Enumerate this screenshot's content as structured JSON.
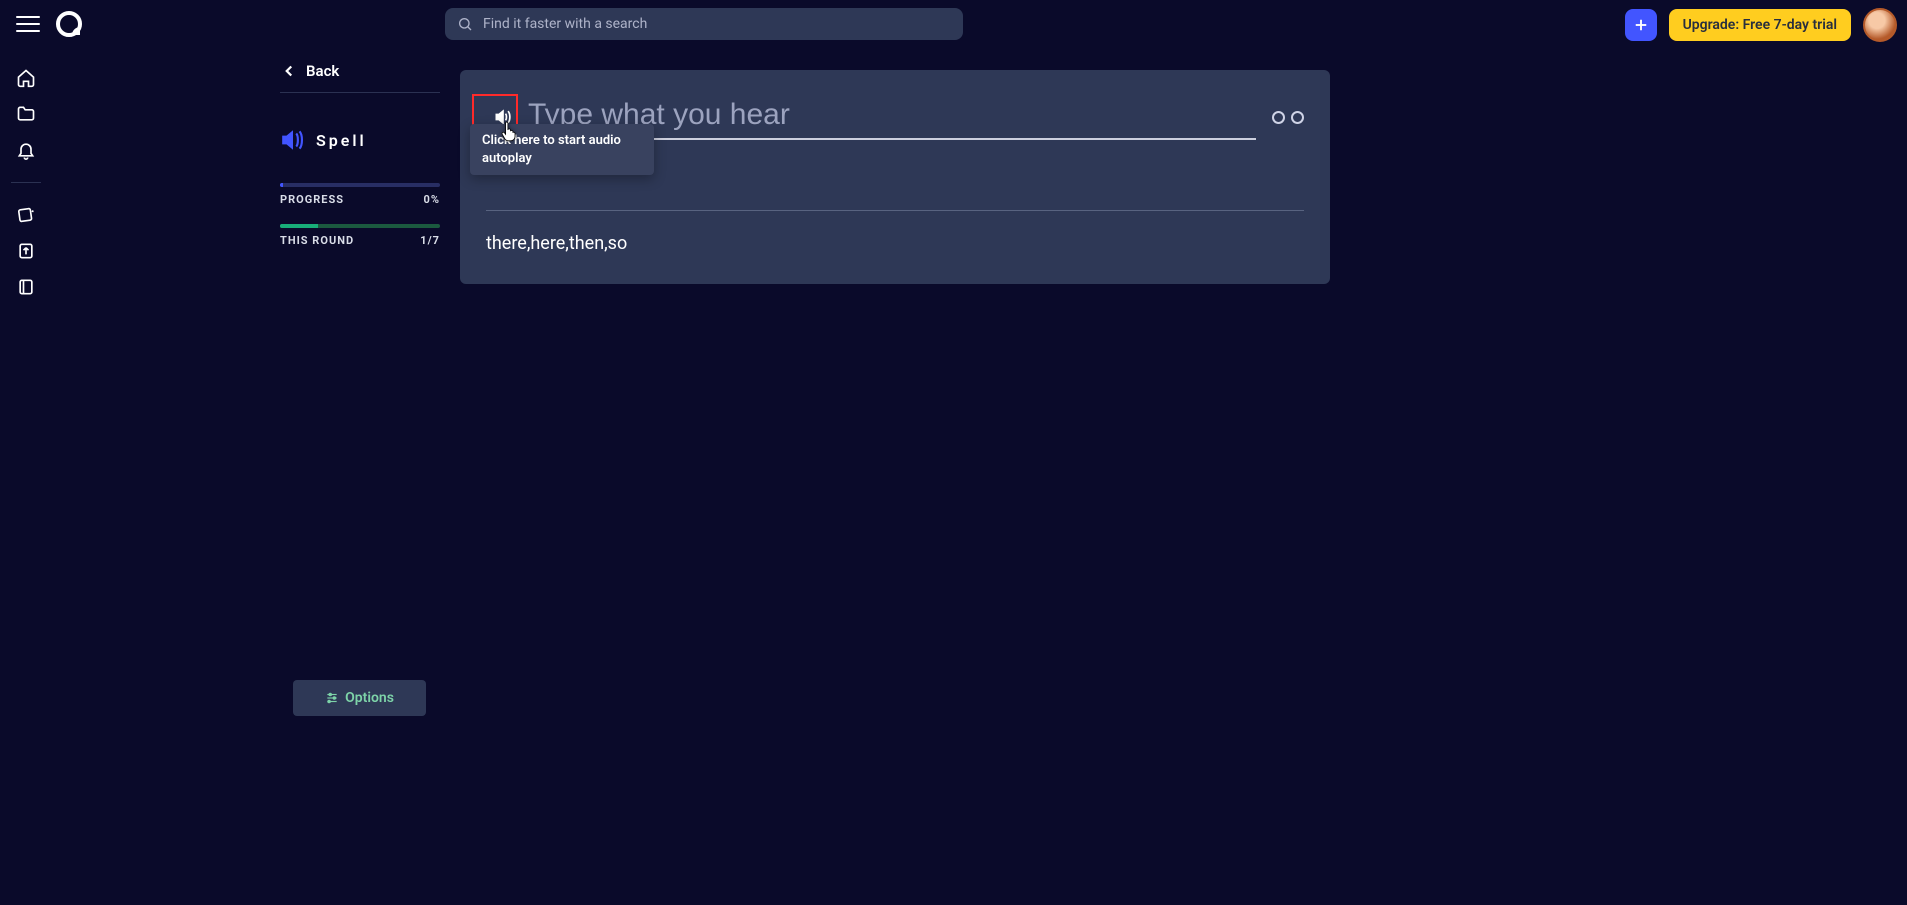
{
  "header": {
    "search_placeholder": "Find it faster with a search",
    "upgrade_label": "Upgrade: Free 7-day trial"
  },
  "left": {
    "back_label": "Back",
    "mode_label": "Spell",
    "progress": {
      "label": "PROGRESS",
      "value": "0%",
      "fill_pct": 2
    },
    "round": {
      "label": "THIS ROUND",
      "value": "1/7",
      "fill_pct": 24
    },
    "options_label": "Options"
  },
  "card": {
    "input_placeholder": "Type what you hear",
    "tooltip_text": "Click here to start audio autoplay",
    "hint_text": "there,here,then,so",
    "dot_count": 2
  }
}
